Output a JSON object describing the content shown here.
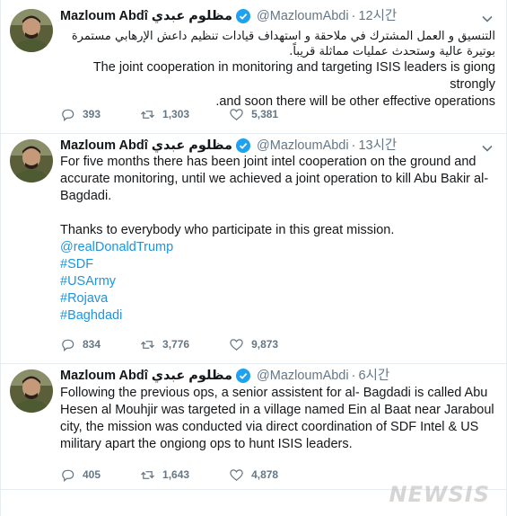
{
  "tweets": [
    {
      "name": "Mazloum Abdî مظلوم عبدي",
      "handle": "@MazloumAbdi",
      "time": "12시간",
      "text_ar": "التنسيق و العمل المشترك في ملاحقة و استهداف قيادات تنظيم داعش الإرهابي مستمرة بوتيرة عالية وستحدث عمليات مماثلة قريباً.",
      "text_en_1": "The joint cooperation in monitoring and targeting ISIS leaders is giong strongly",
      "text_en_2": ".and soon there will be other effective operations",
      "replies": "393",
      "retweets": "1,303",
      "likes": "5,381"
    },
    {
      "name": "Mazloum Abdî مظلوم عبدي",
      "handle": "@MazloumAbdi",
      "time": "13시간",
      "text_1": "For five months there has been  joint intel cooperation on the ground and accurate monitoring, until we achieved a joint operation to kill Abu Bakir al-Bagdadi.",
      "text_2": "Thanks to everybody who participate in this great mission.",
      "hashtags": [
        "@realDonaldTrump",
        "#SDF",
        "#USArmy",
        "#Rojava",
        "#Baghdadi"
      ],
      "replies": "834",
      "retweets": "3,776",
      "likes": "9,873"
    },
    {
      "name": "Mazloum Abdî مظلوم عبدي",
      "handle": "@MazloumAbdi",
      "time": "6시간",
      "text_1": "Following the previous ops, a senior assistent for al- Bagdadi is called Abu Hesen al Mouhjir was targeted in a village named Ein al Baat near Jaraboul city, the mission was conducted via direct coordination of SDF Intel & US military apart the ongiong ops to hunt ISIS leaders.",
      "replies": "405",
      "retweets": "1,643",
      "likes": "4,878"
    }
  ],
  "watermark": "NEWSIS",
  "colors": {
    "link": "#1b95e0",
    "muted": "#657786",
    "verified": "#1da1f2"
  },
  "icons": [
    "verified-badge-icon",
    "chevron-down-icon",
    "reply-icon",
    "retweet-icon",
    "like-icon"
  ]
}
